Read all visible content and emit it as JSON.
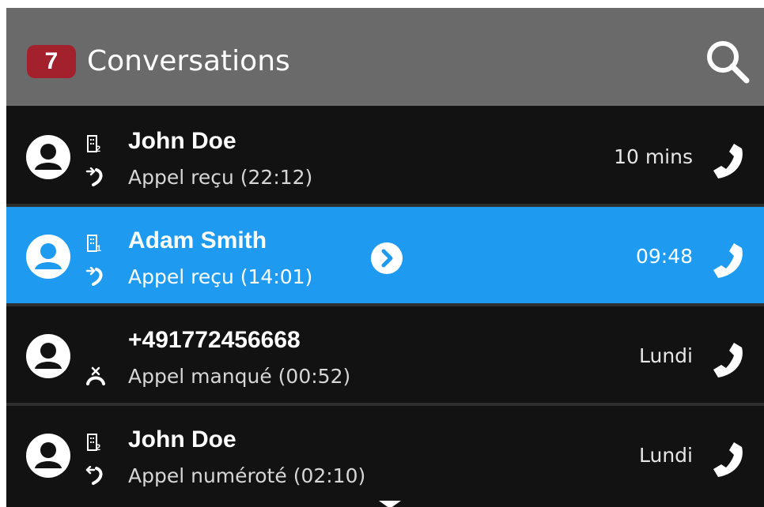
{
  "header": {
    "badge_count": "7",
    "title": "Conversations",
    "search_icon": "search-icon"
  },
  "colors": {
    "header_bg": "#6a6a6a",
    "list_bg": "#121212",
    "selected_bg": "#1e9bf0",
    "badge_bg": "#a3202d"
  },
  "conversations": [
    {
      "name": "John Doe",
      "detail": "Appel reçu (22:12)",
      "time": "10 mins",
      "line_icon": "enterprise-line-2-icon",
      "call_icon": "incoming-call-icon",
      "selected": false
    },
    {
      "name": "Adam Smith",
      "detail": "Appel reçu (14:01)",
      "time": "09:48",
      "line_icon": "enterprise-line-1-icon",
      "call_icon": "incoming-call-icon",
      "selected": true
    },
    {
      "name": "+491772456668",
      "detail": "Appel manqué (00:52)",
      "time": "Lundi",
      "line_icon": "",
      "call_icon": "missed-call-icon",
      "selected": false
    },
    {
      "name": "John Doe",
      "detail": "Appel numéroté (02:10)",
      "time": "Lundi",
      "line_icon": "enterprise-line-2-icon",
      "call_icon": "outgoing-call-icon",
      "selected": false
    }
  ]
}
